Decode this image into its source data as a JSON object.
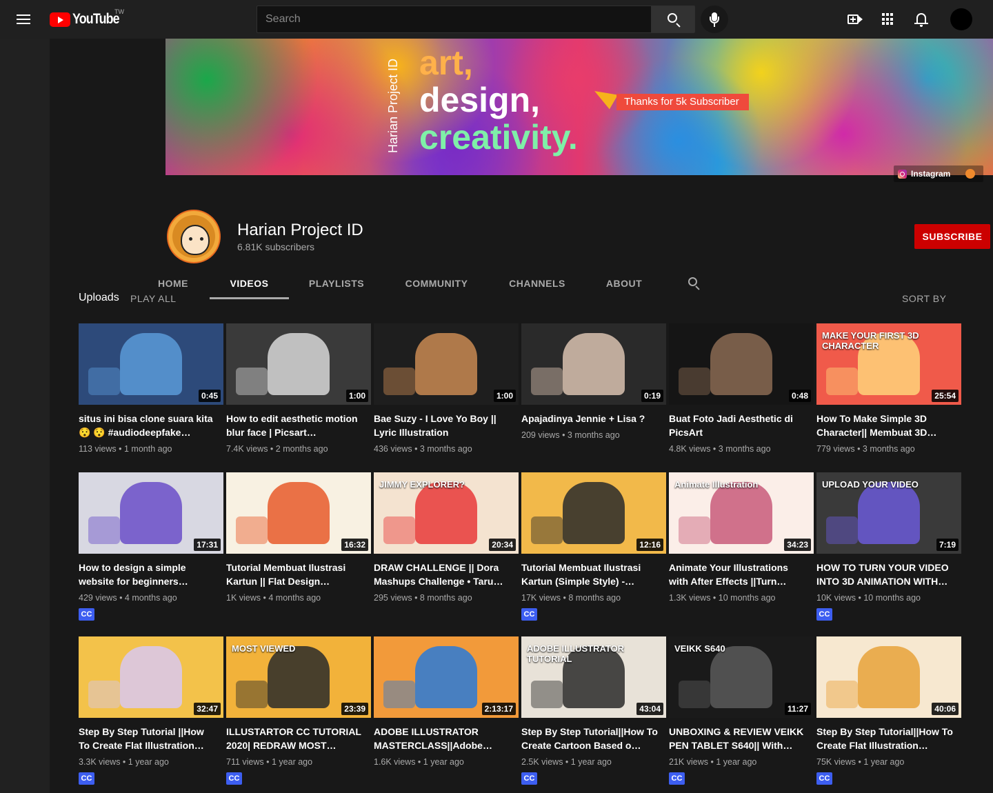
{
  "topbar": {
    "logo_text": "YouTube",
    "region": "TW",
    "search_placeholder": "Search"
  },
  "banner": {
    "vertical_text": "Harian Project ID",
    "line1": "art,",
    "line2": "design,",
    "line3": "creativity.",
    "ribbon": "Thanks for 5k Subscriber",
    "link_label": "Instagram"
  },
  "channel": {
    "name": "Harian Project ID",
    "subscribers": "6.81K subscribers",
    "subscribe_label": "SUBSCRIBE"
  },
  "tabs": [
    "HOME",
    "VIDEOS",
    "PLAYLISTS",
    "COMMUNITY",
    "CHANNELS",
    "ABOUT"
  ],
  "section": {
    "title": "Uploads",
    "play_all": "PLAY ALL",
    "sort_by": "SORT BY"
  },
  "videos": [
    {
      "title": "situs ini bisa clone suara kita 😯 😯  #audiodeepfake…",
      "views": "113 views",
      "age": "1 month ago",
      "duration": "0:45",
      "cc": false,
      "bg": "#2d4a7a",
      "accent": "#5a9ad8"
    },
    {
      "title": "How to edit aesthetic motion blur face | Picsart…",
      "views": "7.4K views",
      "age": "2 months ago",
      "duration": "1:00",
      "cc": false,
      "bg": "#3a3a3a",
      "accent": "#d8d8d8"
    },
    {
      "title": "Bae Suzy - I Love Yo Boy || Lyric Illustration",
      "views": "436 views",
      "age": "3 months ago",
      "duration": "1:00",
      "cc": false,
      "bg": "#1e1e1e",
      "accent": "#c98a52"
    },
    {
      "title": "Apajadinya Jennie + Lisa ?",
      "views": "209 views",
      "age": "3 months ago",
      "duration": "0:19",
      "cc": false,
      "bg": "#2a2a2a",
      "accent": "#d9c2b0"
    },
    {
      "title": "Buat Foto Jadi Aesthetic di PicsArt",
      "views": "4.8K views",
      "age": "3 months ago",
      "duration": "0:48",
      "cc": false,
      "bg": "#151515",
      "accent": "#8a6a52"
    },
    {
      "title": "How To Make Simple 3D Character|| Membuat 3D…",
      "views": "779 views",
      "age": "3 months ago",
      "duration": "25:54",
      "cc": false,
      "bg": "#f05a4a",
      "accent": "#ffd37a",
      "overlay": "MAKE YOUR FIRST 3D CHARACTER"
    },
    {
      "title": "How to design a simple website for beginners…",
      "views": "429 views",
      "age": "4 months ago",
      "duration": "17:31",
      "cc": true,
      "bg": "#d8d8e2",
      "accent": "#6b4fc8"
    },
    {
      "title": "Tutorial Membuat Ilustrasi Kartun || Flat Design…",
      "views": "1K views",
      "age": "4 months ago",
      "duration": "16:32",
      "cc": false,
      "bg": "#f8f1e2",
      "accent": "#e85a2a"
    },
    {
      "title": "DRAW CHALLENGE || Dora Mashups Challenge • Taru…",
      "views": "295 views",
      "age": "8 months ago",
      "duration": "20:34",
      "cc": false,
      "bg": "#f4e3d0",
      "accent": "#e83a3a",
      "overlay": "JIMMY EXPLORER?"
    },
    {
      "title": "Tutorial Membuat Ilustrasi Kartun (Simple Style) -…",
      "views": "17K views",
      "age": "8 months ago",
      "duration": "12:16",
      "cc": true,
      "bg": "#f2b94a",
      "accent": "#2a2a2a"
    },
    {
      "title": "Animate Your Illustrations with After Effects ||Turn…",
      "views": "1.3K views",
      "age": "10 months ago",
      "duration": "34:23",
      "cc": false,
      "bg": "#fbeee8",
      "accent": "#c85a7a",
      "overlay": "Animate Illustration"
    },
    {
      "title": "HOW TO TURN YOUR VIDEO INTO 3D ANIMATION WITH…",
      "views": "10K views",
      "age": "10 months ago",
      "duration": "7:19",
      "cc": true,
      "bg": "#3a3a3a",
      "accent": "#6b5ad8",
      "overlay": "UPLOAD YOUR VIDEO"
    },
    {
      "title": "Step By Step Tutorial ||How To Create Flat Illustration…",
      "views": "3.3K views",
      "age": "1 year ago",
      "duration": "32:47",
      "cc": true,
      "bg": "#f3c24a",
      "accent": "#d8c8f0"
    },
    {
      "title": "ILLUSTARTOR CC TUTORIAL 2020| REDRAW MOST…",
      "views": "711 views",
      "age": "1 year ago",
      "duration": "23:39",
      "cc": true,
      "bg": "#f2b23a",
      "accent": "#2a2a2a",
      "overlay": "MOST VIEWED"
    },
    {
      "title": "ADOBE ILLUSTRATOR MASTERCLASS||Adobe…",
      "views": "1.6K views",
      "age": "1 year ago",
      "duration": "2:13:17",
      "cc": false,
      "bg": "#f29a3a",
      "accent": "#2a7ad8"
    },
    {
      "title": "Step By Step Tutorial||How To Create Cartoon Based o…",
      "views": "2.5K views",
      "age": "1 year ago",
      "duration": "43:04",
      "cc": true,
      "bg": "#e8e2d8",
      "accent": "#2a2a2a",
      "overlay": "ADOBE ILLUSTRATOR TUTORIAL"
    },
    {
      "title": "UNBOXING & REVIEW VEIKK PEN TABLET S640|| With…",
      "views": "21K views",
      "age": "1 year ago",
      "duration": "11:27",
      "cc": true,
      "bg": "#1a1a1a",
      "accent": "#5a5a5a",
      "overlay": "VEIKK S640"
    },
    {
      "title": "Step By Step Tutorial||How To Create Flat Illustration…",
      "views": "75K views",
      "age": "1 year ago",
      "duration": "40:06",
      "cc": true,
      "bg": "#f7e8d0",
      "accent": "#e8a23a"
    }
  ]
}
